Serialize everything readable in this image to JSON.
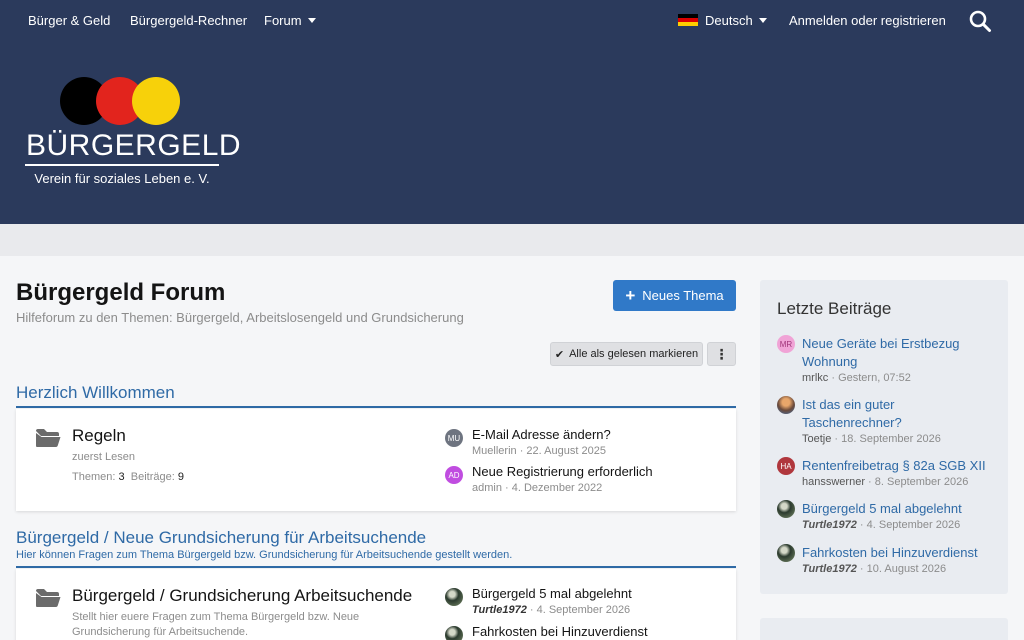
{
  "nav": {
    "links": [
      "Bürger & Geld",
      "Bürgergeld-Rechner",
      "Forum"
    ],
    "language": "Deutsch",
    "login": "Anmelden oder registrieren",
    "search_icon": "search-icon"
  },
  "logo": {
    "title": "BÜRGERGELD",
    "subtitle": "Verein für soziales Leben e. V."
  },
  "page": {
    "title": "Bürgergeld Forum",
    "description": "Hilfeforum zu den Themen: Bürgergeld, Arbeitslosengeld und Grundsicherung",
    "new_thread": "Neues Thema",
    "mark_read": "Alle als gelesen markieren"
  },
  "categories": [
    {
      "title": "Herzlich Willkommen",
      "forums": [
        {
          "name": "Regeln",
          "description": "zuerst Lesen",
          "stats": {
            "threads_label": "Themen",
            "threads": "3",
            "posts_label": "Beiträge",
            "posts": "9"
          },
          "latest": [
            {
              "avatar": "MU",
              "avatar_color": "#6e7480",
              "title": "E-Mail Adresse ändern?",
              "user": "Muellerin",
              "date": "22. August 2025"
            },
            {
              "avatar": "AD",
              "avatar_color": "#c04de0",
              "title": "Neue Registrierung erforderlich",
              "user": "admin",
              "date": "4. Dezember 2022"
            }
          ]
        }
      ]
    },
    {
      "title": "Bürgergeld / Neue Grundsicherung für Arbeitsuchende",
      "description": "Hier können Fragen zum Thema Bürgergeld bzw. Grundsicherung für Arbeitsuchende gestellt werden.",
      "forums": [
        {
          "name": "Bürgergeld / Grundsicherung Arbeitsuchende",
          "description": "Stellt hier euere Fragen zum Thema Bürgergeld bzw. Neue Grundsicherung für Arbeitsuchende.",
          "latest": [
            {
              "avatar": "",
              "title": "Bürgergeld 5 mal abgelehnt",
              "user": "Turtle1972",
              "date": "4. September 2026"
            },
            {
              "avatar": "",
              "title": "Fahrkosten bei Hinzuverdienst",
              "user": "",
              "date": ""
            }
          ]
        }
      ]
    }
  ],
  "sidebar": {
    "title": "Letzte Beiträge",
    "items": [
      {
        "avatar": "MR",
        "avatar_color": "#f0a3d6",
        "title": "Neue Geräte bei Erstbezug\nWohnung",
        "user": "mrlkc",
        "time": "Gestern, 07:52"
      },
      {
        "avatar": "",
        "title": "Ist das ein guter\nTaschenrechner?",
        "user": "Toetje",
        "time": "18. September 2026"
      },
      {
        "avatar": "HA",
        "avatar_color": "#b0373d",
        "title": "Rentenfreibetrag § 82a SGB XII",
        "user": "hansswerner",
        "time": "8. September 2026"
      },
      {
        "avatar": "",
        "title": "Bürgergeld 5 mal abgelehnt",
        "user": "Turtle1972",
        "time": "4. September 2026"
      },
      {
        "avatar": "",
        "title": "Fahrkosten bei Hinzuverdienst",
        "user": "Turtle1972",
        "time": "10. August 2026"
      }
    ]
  },
  "colors": {
    "header_bg": "#2b3a5c",
    "accent": "#2f6aa6",
    "button_primary": "#3079c8"
  }
}
